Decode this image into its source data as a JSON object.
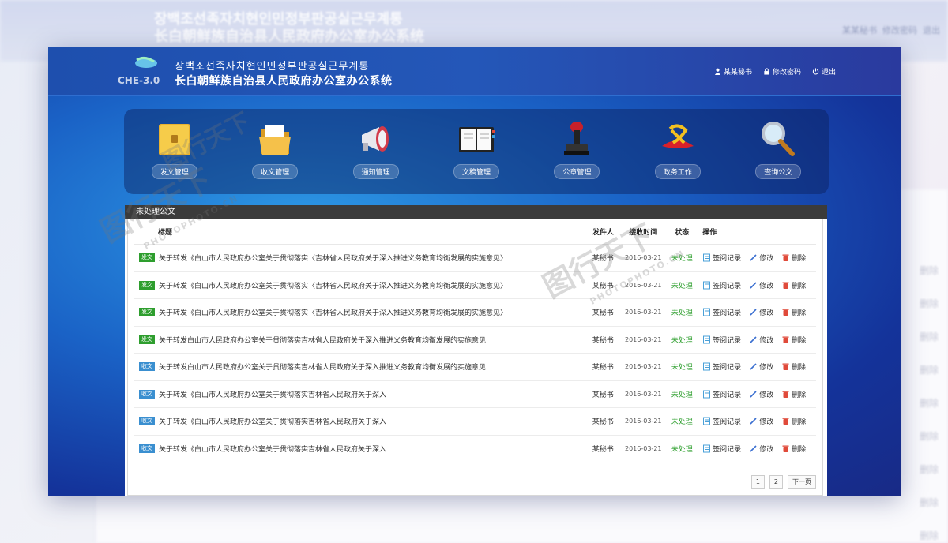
{
  "header": {
    "title_ko": "장백조선족자치현인민정부판공실근무계통",
    "title_zh": "长白朝鲜族自治县人民政府办公室办公系统",
    "user": "某某秘书",
    "change_password": "修改密码",
    "logout": "退出",
    "logo_text": "CHE-3.0"
  },
  "nav": [
    {
      "label": "发文管理",
      "icon": "folder-yellow-icon"
    },
    {
      "label": "收文管理",
      "icon": "folder-open-icon"
    },
    {
      "label": "通知管理",
      "icon": "megaphone-icon"
    },
    {
      "label": "文稿管理",
      "icon": "notebook-icon"
    },
    {
      "label": "公章管理",
      "icon": "stamp-icon"
    },
    {
      "label": "政务工作",
      "icon": "party-emblem-icon"
    },
    {
      "label": "查询公文",
      "icon": "magnifier-icon"
    }
  ],
  "panel": {
    "title": "未处理公文",
    "columns": {
      "title": "标题",
      "sender": "发件人",
      "date": "接收时间",
      "status": "状态",
      "ops": "操作"
    },
    "ops": {
      "sign": "签阅记录",
      "edit": "修改",
      "delete": "删除"
    },
    "colors": {
      "send_tag": "#2e9e2e",
      "receive_tag": "#3a8fd0",
      "status": "#2a9d2a",
      "delete": "#e04a3a",
      "edit": "#3a6fd0",
      "sign": "#4aa0d8"
    },
    "rows": [
      {
        "tag": "发文",
        "tag_type": "send",
        "title": "关于转发《白山市人民政府办公室关于贯彻落实〈吉林省人民政府关于深入推进义务教育均衡发展的实施意见〉",
        "sender": "某秘书",
        "date": "2016-03-21",
        "status": "未处理"
      },
      {
        "tag": "发文",
        "tag_type": "send",
        "title": "关于转发《白山市人民政府办公室关于贯彻落实〈吉林省人民政府关于深入推进义务教育均衡发展的实施意见〉",
        "sender": "某秘书",
        "date": "2016-03-21",
        "status": "未处理"
      },
      {
        "tag": "发文",
        "tag_type": "send",
        "title": "关于转发《白山市人民政府办公室关于贯彻落实〈吉林省人民政府关于深入推进义务教育均衡发展的实施意见〉",
        "sender": "某秘书",
        "date": "2016-03-21",
        "status": "未处理"
      },
      {
        "tag": "发文",
        "tag_type": "send",
        "title": "关于转发白山市人民政府办公室关于贯彻落实吉林省人民政府关于深入推进义务教育均衡发展的实施意见",
        "sender": "某秘书",
        "date": "2016-03-21",
        "status": "未处理"
      },
      {
        "tag": "收文",
        "tag_type": "receive",
        "title": "关于转发白山市人民政府办公室关于贯彻落实吉林省人民政府关于深入推进义务教育均衡发展的实施意见",
        "sender": "某秘书",
        "date": "2016-03-21",
        "status": "未处理"
      },
      {
        "tag": "收文",
        "tag_type": "receive",
        "title": "关于转发《白山市人民政府办公室关于贯彻落实吉林省人民政府关于深入",
        "sender": "某秘书",
        "date": "2016-03-21",
        "status": "未处理"
      },
      {
        "tag": "收文",
        "tag_type": "receive",
        "title": "关于转发《白山市人民政府办公室关于贯彻落实吉林省人民政府关于深入",
        "sender": "某秘书",
        "date": "2016-03-21",
        "status": "未处理"
      },
      {
        "tag": "收文",
        "tag_type": "receive",
        "title": "关于转发《白山市人民政府办公室关于贯彻落实吉林省人民政府关于深入",
        "sender": "某秘书",
        "date": "2016-03-21",
        "status": "未处理"
      }
    ],
    "pager": [
      "1",
      "2",
      "下一页"
    ]
  },
  "watermark": {
    "cn": "图行天下",
    "en": "PHOTOPHOTO.CN"
  }
}
